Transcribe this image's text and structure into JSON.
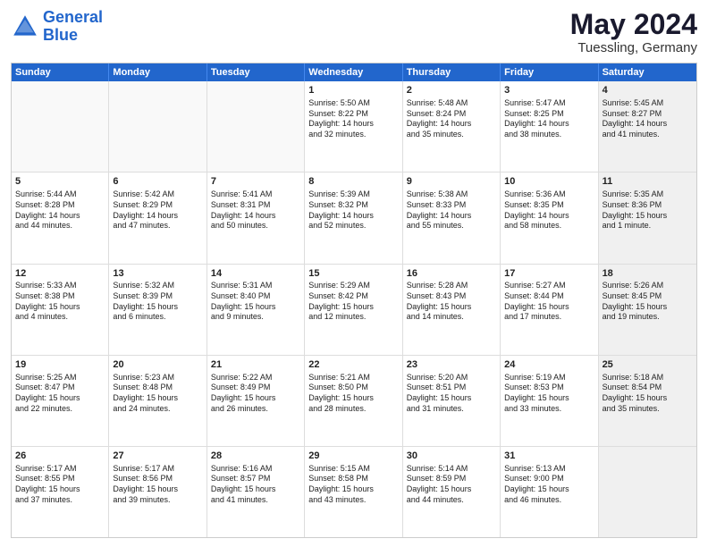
{
  "header": {
    "logo_line1": "General",
    "logo_line2": "Blue",
    "main_title": "May 2024",
    "subtitle": "Tuessling, Germany"
  },
  "calendar": {
    "weekdays": [
      "Sunday",
      "Monday",
      "Tuesday",
      "Wednesday",
      "Thursday",
      "Friday",
      "Saturday"
    ],
    "rows": [
      [
        {
          "day": "",
          "lines": [],
          "empty": true
        },
        {
          "day": "",
          "lines": [],
          "empty": true
        },
        {
          "day": "",
          "lines": [],
          "empty": true
        },
        {
          "day": "1",
          "lines": [
            "Sunrise: 5:50 AM",
            "Sunset: 8:22 PM",
            "Daylight: 14 hours",
            "and 32 minutes."
          ]
        },
        {
          "day": "2",
          "lines": [
            "Sunrise: 5:48 AM",
            "Sunset: 8:24 PM",
            "Daylight: 14 hours",
            "and 35 minutes."
          ]
        },
        {
          "day": "3",
          "lines": [
            "Sunrise: 5:47 AM",
            "Sunset: 8:25 PM",
            "Daylight: 14 hours",
            "and 38 minutes."
          ]
        },
        {
          "day": "4",
          "lines": [
            "Sunrise: 5:45 AM",
            "Sunset: 8:27 PM",
            "Daylight: 14 hours",
            "and 41 minutes."
          ],
          "shaded": true
        }
      ],
      [
        {
          "day": "5",
          "lines": [
            "Sunrise: 5:44 AM",
            "Sunset: 8:28 PM",
            "Daylight: 14 hours",
            "and 44 minutes."
          ]
        },
        {
          "day": "6",
          "lines": [
            "Sunrise: 5:42 AM",
            "Sunset: 8:29 PM",
            "Daylight: 14 hours",
            "and 47 minutes."
          ]
        },
        {
          "day": "7",
          "lines": [
            "Sunrise: 5:41 AM",
            "Sunset: 8:31 PM",
            "Daylight: 14 hours",
            "and 50 minutes."
          ]
        },
        {
          "day": "8",
          "lines": [
            "Sunrise: 5:39 AM",
            "Sunset: 8:32 PM",
            "Daylight: 14 hours",
            "and 52 minutes."
          ]
        },
        {
          "day": "9",
          "lines": [
            "Sunrise: 5:38 AM",
            "Sunset: 8:33 PM",
            "Daylight: 14 hours",
            "and 55 minutes."
          ]
        },
        {
          "day": "10",
          "lines": [
            "Sunrise: 5:36 AM",
            "Sunset: 8:35 PM",
            "Daylight: 14 hours",
            "and 58 minutes."
          ]
        },
        {
          "day": "11",
          "lines": [
            "Sunrise: 5:35 AM",
            "Sunset: 8:36 PM",
            "Daylight: 15 hours",
            "and 1 minute."
          ],
          "shaded": true
        }
      ],
      [
        {
          "day": "12",
          "lines": [
            "Sunrise: 5:33 AM",
            "Sunset: 8:38 PM",
            "Daylight: 15 hours",
            "and 4 minutes."
          ]
        },
        {
          "day": "13",
          "lines": [
            "Sunrise: 5:32 AM",
            "Sunset: 8:39 PM",
            "Daylight: 15 hours",
            "and 6 minutes."
          ]
        },
        {
          "day": "14",
          "lines": [
            "Sunrise: 5:31 AM",
            "Sunset: 8:40 PM",
            "Daylight: 15 hours",
            "and 9 minutes."
          ]
        },
        {
          "day": "15",
          "lines": [
            "Sunrise: 5:29 AM",
            "Sunset: 8:42 PM",
            "Daylight: 15 hours",
            "and 12 minutes."
          ]
        },
        {
          "day": "16",
          "lines": [
            "Sunrise: 5:28 AM",
            "Sunset: 8:43 PM",
            "Daylight: 15 hours",
            "and 14 minutes."
          ]
        },
        {
          "day": "17",
          "lines": [
            "Sunrise: 5:27 AM",
            "Sunset: 8:44 PM",
            "Daylight: 15 hours",
            "and 17 minutes."
          ]
        },
        {
          "day": "18",
          "lines": [
            "Sunrise: 5:26 AM",
            "Sunset: 8:45 PM",
            "Daylight: 15 hours",
            "and 19 minutes."
          ],
          "shaded": true
        }
      ],
      [
        {
          "day": "19",
          "lines": [
            "Sunrise: 5:25 AM",
            "Sunset: 8:47 PM",
            "Daylight: 15 hours",
            "and 22 minutes."
          ]
        },
        {
          "day": "20",
          "lines": [
            "Sunrise: 5:23 AM",
            "Sunset: 8:48 PM",
            "Daylight: 15 hours",
            "and 24 minutes."
          ]
        },
        {
          "day": "21",
          "lines": [
            "Sunrise: 5:22 AM",
            "Sunset: 8:49 PM",
            "Daylight: 15 hours",
            "and 26 minutes."
          ]
        },
        {
          "day": "22",
          "lines": [
            "Sunrise: 5:21 AM",
            "Sunset: 8:50 PM",
            "Daylight: 15 hours",
            "and 28 minutes."
          ]
        },
        {
          "day": "23",
          "lines": [
            "Sunrise: 5:20 AM",
            "Sunset: 8:51 PM",
            "Daylight: 15 hours",
            "and 31 minutes."
          ]
        },
        {
          "day": "24",
          "lines": [
            "Sunrise: 5:19 AM",
            "Sunset: 8:53 PM",
            "Daylight: 15 hours",
            "and 33 minutes."
          ]
        },
        {
          "day": "25",
          "lines": [
            "Sunrise: 5:18 AM",
            "Sunset: 8:54 PM",
            "Daylight: 15 hours",
            "and 35 minutes."
          ],
          "shaded": true
        }
      ],
      [
        {
          "day": "26",
          "lines": [
            "Sunrise: 5:17 AM",
            "Sunset: 8:55 PM",
            "Daylight: 15 hours",
            "and 37 minutes."
          ]
        },
        {
          "day": "27",
          "lines": [
            "Sunrise: 5:17 AM",
            "Sunset: 8:56 PM",
            "Daylight: 15 hours",
            "and 39 minutes."
          ]
        },
        {
          "day": "28",
          "lines": [
            "Sunrise: 5:16 AM",
            "Sunset: 8:57 PM",
            "Daylight: 15 hours",
            "and 41 minutes."
          ]
        },
        {
          "day": "29",
          "lines": [
            "Sunrise: 5:15 AM",
            "Sunset: 8:58 PM",
            "Daylight: 15 hours",
            "and 43 minutes."
          ]
        },
        {
          "day": "30",
          "lines": [
            "Sunrise: 5:14 AM",
            "Sunset: 8:59 PM",
            "Daylight: 15 hours",
            "and 44 minutes."
          ]
        },
        {
          "day": "31",
          "lines": [
            "Sunrise: 5:13 AM",
            "Sunset: 9:00 PM",
            "Daylight: 15 hours",
            "and 46 minutes."
          ]
        },
        {
          "day": "",
          "lines": [],
          "empty": true,
          "shaded": true
        }
      ]
    ]
  }
}
